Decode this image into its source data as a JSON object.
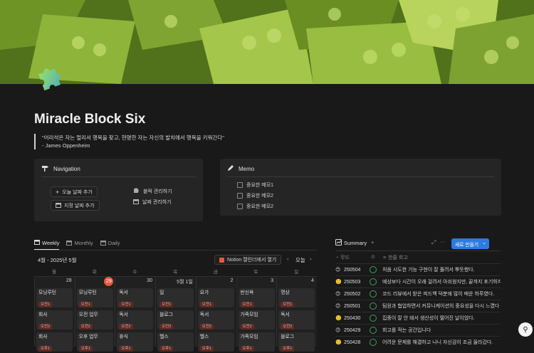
{
  "page": {
    "title": "Miracle Block Six",
    "quote_line1": "\"어리석은 자는 멀리서 행복을 찾고, 현명한 자는 자신의 발치에서 행복을 키워간다\"",
    "quote_line2": "- James Oppenheim"
  },
  "navigation": {
    "title": "Navigation",
    "add_today": "오늘 날짜 추가",
    "add_date": "지정 날짜 추가",
    "manage_blocks": "블럭 관리하기",
    "manage_dates": "날짜 관리하기"
  },
  "memo": {
    "title": "Memo",
    "items": [
      "중요한 메모1",
      "중요한 메모2",
      "중요한 메모2"
    ]
  },
  "calendar": {
    "tabs": [
      "Weekly",
      "Monthly",
      "Daily"
    ],
    "range": "4월 - 2025년 5월",
    "notion_button": "Notion 캘린더에서 열기",
    "today_button": "오늘",
    "weekdays": [
      "월",
      "화",
      "수",
      "목",
      "금",
      "토",
      "일"
    ],
    "days": [
      "28",
      "29",
      "30",
      "5월 1일",
      "2",
      "3",
      "4"
    ],
    "events": [
      [
        {
          "name": "모닝루틴",
          "tag": "오전1"
        },
        {
          "name": "회사",
          "tag": "오전2"
        },
        {
          "name": "회사",
          "tag": "오후1"
        }
      ],
      [
        {
          "name": "모닝루틴",
          "tag": "오전1"
        },
        {
          "name": "오전 업무",
          "tag": "오전2"
        },
        {
          "name": "오후 업무",
          "tag": "오후1"
        }
      ],
      [
        {
          "name": "독서",
          "tag": "오전1"
        },
        {
          "name": "독서",
          "tag": "오전2"
        },
        {
          "name": "휴식",
          "tag": "오후1"
        }
      ],
      [
        {
          "name": "일",
          "tag": "오전1"
        },
        {
          "name": "블로그",
          "tag": "오전2"
        },
        {
          "name": "헬스",
          "tag": "오후1"
        }
      ],
      [
        {
          "name": "요가",
          "tag": "오전1"
        },
        {
          "name": "독서",
          "tag": "오전2"
        },
        {
          "name": "헬스",
          "tag": "오후1"
        }
      ],
      [
        {
          "name": "반신욕",
          "tag": "오전1"
        },
        {
          "name": "가족모임",
          "tag": "오전2"
        },
        {
          "name": "가족모임",
          "tag": "오후1"
        }
      ],
      [
        {
          "name": "명상",
          "tag": "오전1"
        },
        {
          "name": "독서",
          "tag": "오전2"
        },
        {
          "name": "블로그",
          "tag": "오후1"
        }
      ]
    ]
  },
  "summary": {
    "title": "Summary",
    "new_button": "새로 만들기",
    "col_date": "무드",
    "col_text": "한줄 회고",
    "rows": [
      {
        "emoji": "😊",
        "date": "250504",
        "text": "처음 시도한 기능 구현이 잘 풀려서 뿌듯했다."
      },
      {
        "emoji": "🙂",
        "date": "250503",
        "text": "예상보다 시간이 오래 걸려서 아쉬웠지만, 끝까지 포기하지 않"
      },
      {
        "emoji": "😊",
        "date": "250502",
        "text": "코드 리뷰에서 받은 피드백 덕분에 많이 배운 하루였다."
      },
      {
        "emoji": "😊",
        "date": "250501",
        "text": "팀원과 협업하면서 커뮤니케이션의 중요성을 다시 느꼈다"
      },
      {
        "emoji": "🙂",
        "date": "250430",
        "text": "집중이 잘 안 돼서 생산성이 떨어진 날이었다."
      },
      {
        "emoji": "😊",
        "date": "250429",
        "text": "회고를 적는 공간입니다"
      },
      {
        "emoji": "🙂",
        "date": "250428",
        "text": "어려운 문제를 해결하고 나니 자신감이 조금 올라갔다."
      }
    ]
  },
  "colors": {
    "accent": "#2d7be0",
    "today": "#e05a3f",
    "tag_bg": "#5b2b25",
    "done_ring": "#3fa05a"
  }
}
